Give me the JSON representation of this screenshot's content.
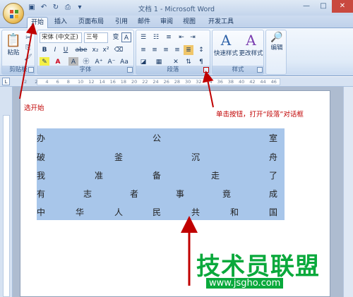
{
  "window": {
    "title": "文档 1 - Microsoft Word"
  },
  "tabs": [
    "开始",
    "插入",
    "页面布局",
    "引用",
    "邮件",
    "审阅",
    "视图",
    "开发工具"
  ],
  "ribbon": {
    "clipboard": {
      "label": "剪贴板",
      "paste": "粘贴"
    },
    "font": {
      "label": "字体",
      "font_name": "宋体 (中文正)",
      "font_size": "三号",
      "bold": "B",
      "italic": "I",
      "underline": "U",
      "strike": "abe",
      "sub": "x₂",
      "sup": "x²"
    },
    "paragraph": {
      "label": "段落"
    },
    "styles": {
      "label": "样式",
      "quick_styles": "快速样式",
      "change_styles": "更改样式"
    },
    "editing": {
      "label": "编辑"
    }
  },
  "ruler": {
    "ticks": [
      "2",
      "2",
      "4",
      "6",
      "8",
      "10",
      "12",
      "14",
      "16",
      "18",
      "20",
      "22",
      "24",
      "26",
      "28",
      "30",
      "32",
      "34",
      "36",
      "38",
      "40",
      "42",
      "44",
      "46"
    ]
  },
  "document": {
    "rows": [
      [
        "办",
        "公",
        "室"
      ],
      [
        "破",
        "釜",
        "沉",
        "舟"
      ],
      [
        "我",
        "准",
        "备",
        "走",
        "了"
      ],
      [
        "有",
        "志",
        "者",
        "事",
        "竟",
        "成"
      ],
      [
        "中",
        "华",
        "人",
        "民",
        "共",
        "和",
        "国"
      ]
    ]
  },
  "annotations": {
    "select_start": "选开始",
    "click_button": "单击按钮，打开“段落”对话框"
  },
  "watermark": {
    "cn": "技术员联盟",
    "url": "www.jsgho.com"
  },
  "colors": {
    "annotation": "#c00000",
    "selection": "#a8c6ea",
    "watermark": "#0aa93c"
  }
}
